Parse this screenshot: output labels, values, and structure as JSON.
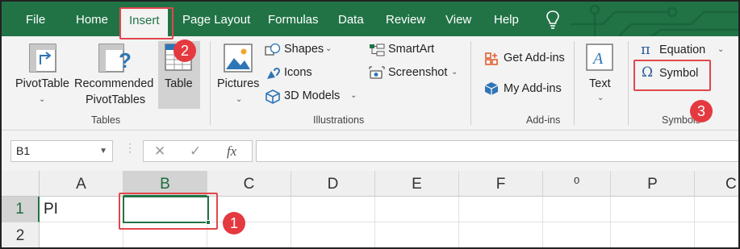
{
  "tabs": [
    "File",
    "Home",
    "Insert",
    "Page Layout",
    "Formulas",
    "Data",
    "Review",
    "View",
    "Help"
  ],
  "active_tab": "Insert",
  "colors": {
    "brand": "#217346",
    "callout": "#e0474c"
  },
  "ribbon": {
    "tables": {
      "group_label": "Tables",
      "pivottable": "PivotTable",
      "recommended_1": "Recommended",
      "recommended_2": "PivotTables",
      "table": "Table"
    },
    "illustrations": {
      "group_label": "Illustrations",
      "pictures": "Pictures",
      "shapes": "Shapes",
      "icons": "Icons",
      "models": "3D Models",
      "smartart": "SmartArt",
      "screenshot": "Screenshot"
    },
    "addins": {
      "group_label": "Add-ins",
      "get": "Get Add-ins",
      "my": "My Add-ins"
    },
    "text": {
      "label": "Text"
    },
    "symbols": {
      "group_label": "Symbols",
      "equation": "Equation",
      "symbol": "Symbol"
    }
  },
  "formula_bar": {
    "name_box": "B1",
    "fx": "fx",
    "value": ""
  },
  "grid": {
    "columns": [
      "A",
      "B",
      "C",
      "D",
      "E",
      "F",
      "⁰",
      "P",
      "C"
    ],
    "rows": [
      "1",
      "2"
    ],
    "cells": {
      "A1": "PI"
    }
  },
  "steps": [
    "1",
    "2",
    "3"
  ]
}
